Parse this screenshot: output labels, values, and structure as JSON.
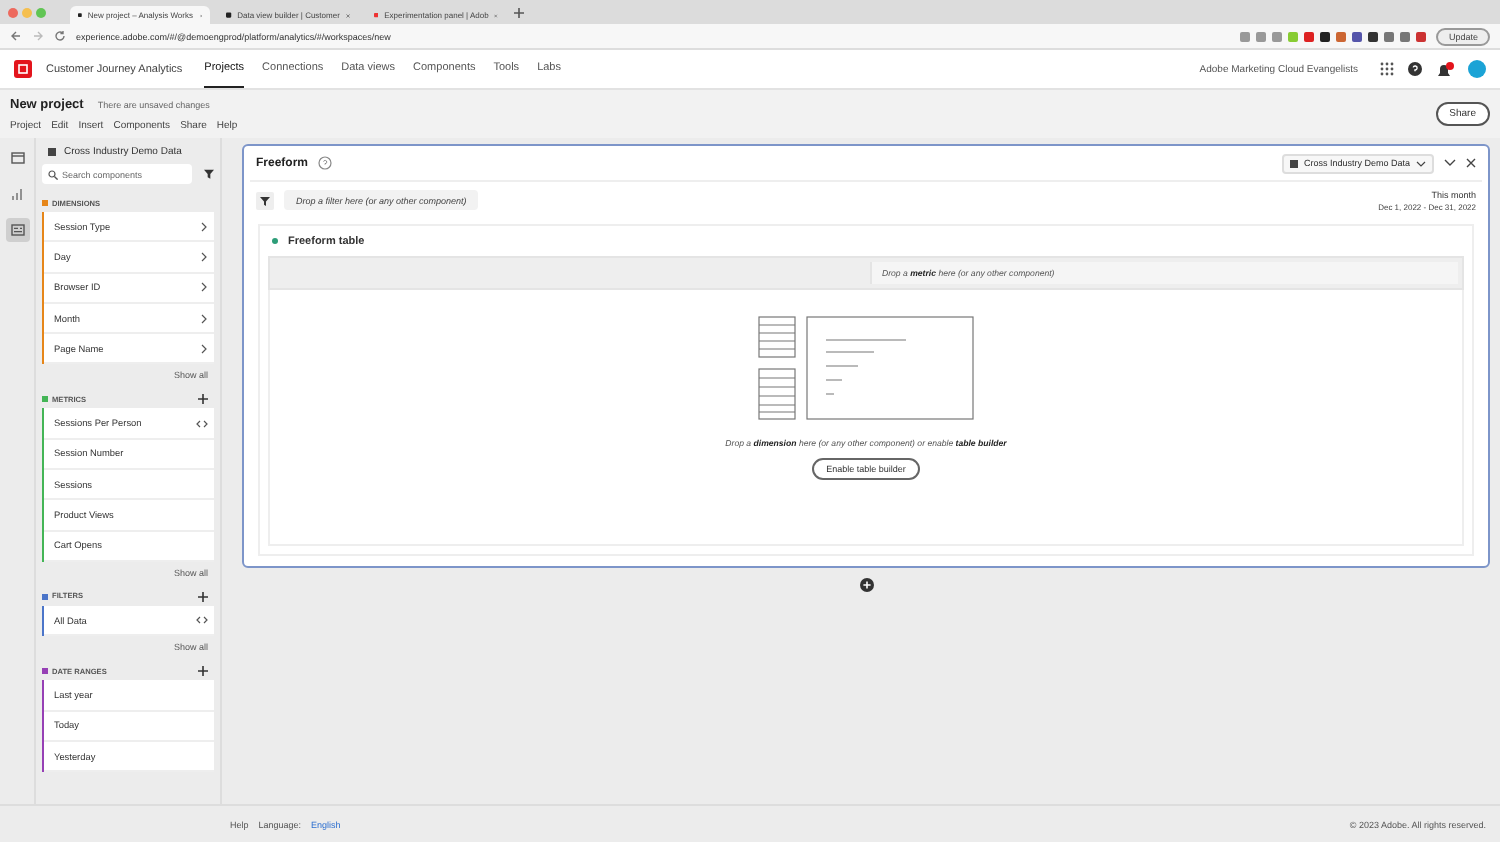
{
  "browser": {
    "tabs": [
      {
        "title": "New project – Analysis Works",
        "selected": true
      },
      {
        "title": "Data view builder | Customer",
        "selected": false
      },
      {
        "title": "Experimentation panel | Adob",
        "selected": false
      }
    ],
    "url": "experience.adobe.com/#/@demoengprod/platform/analytics/#/workspaces/new",
    "update_button": "Update"
  },
  "app": {
    "product": "Customer Journey Analytics",
    "nav": [
      {
        "label": "Projects",
        "selected": true
      },
      {
        "label": "Connections",
        "selected": false
      },
      {
        "label": "Data views",
        "selected": false
      },
      {
        "label": "Components",
        "selected": false
      },
      {
        "label": "Tools",
        "selected": false
      },
      {
        "label": "Labs",
        "selected": false
      }
    ],
    "account": "Adobe Marketing Cloud Evangelists"
  },
  "project": {
    "title": "New project",
    "status": "There are unsaved changes",
    "menu": [
      "Project",
      "Edit",
      "Insert",
      "Components",
      "Share",
      "Help"
    ],
    "share_button": "Share"
  },
  "rail": [
    {
      "selected": false
    },
    {
      "selected": false
    },
    {
      "selected": true
    }
  ],
  "components": {
    "dataset": "Cross Industry Demo Data",
    "search": {
      "placeholder": "Search components"
    },
    "sections": [
      {
        "title": "DIMENSIONS",
        "color": "#e68619",
        "addable": false,
        "items": [
          {
            "label": "Session Type",
            "kind": "expandable"
          },
          {
            "label": "Day",
            "kind": "expandable"
          },
          {
            "label": "Browser ID",
            "kind": "expandable"
          },
          {
            "label": "Month",
            "kind": "expandable"
          },
          {
            "label": "Page Name",
            "kind": "expandable"
          }
        ],
        "show_all": "Show all"
      },
      {
        "title": "METRICS",
        "color": "#44b556",
        "addable": true,
        "items": [
          {
            "label": "Sessions Per Person",
            "kind": "editable"
          },
          {
            "label": "Session Number",
            "kind": "plain"
          },
          {
            "label": "Sessions",
            "kind": "plain"
          },
          {
            "label": "Product Views",
            "kind": "plain"
          },
          {
            "label": "Cart Opens",
            "kind": "plain"
          }
        ],
        "show_all": "Show all"
      },
      {
        "title": "FILTERS",
        "color": "#4b75c9",
        "addable": true,
        "items": [
          {
            "label": "All Data",
            "kind": "editable"
          }
        ],
        "show_all": "Show all"
      },
      {
        "title": "DATE RANGES",
        "color": "#9640b5",
        "addable": true,
        "items": [
          {
            "label": "Last year",
            "kind": "plain"
          },
          {
            "label": "Today",
            "kind": "plain"
          },
          {
            "label": "Yesterday",
            "kind": "plain"
          }
        ]
      }
    ]
  },
  "panel": {
    "title": "Freeform",
    "dataset": "Cross Industry Demo Data",
    "filter_drop": "Drop a filter here (or any other component)",
    "date_label": "This month",
    "date_range": "Dec 1, 2022 - Dec 31, 2022",
    "table": {
      "title": "Freeform table",
      "metric_drop": "Drop a **metric** here (or any other component)",
      "dimension_drop": "Drop a **dimension** here (or any other component) or enable **table builder**",
      "builder_button": "Enable table builder"
    }
  },
  "footer": {
    "help": "Help",
    "language_label": "Language:",
    "language": "English",
    "copyright": "© 2023 Adobe. All rights reserved."
  }
}
